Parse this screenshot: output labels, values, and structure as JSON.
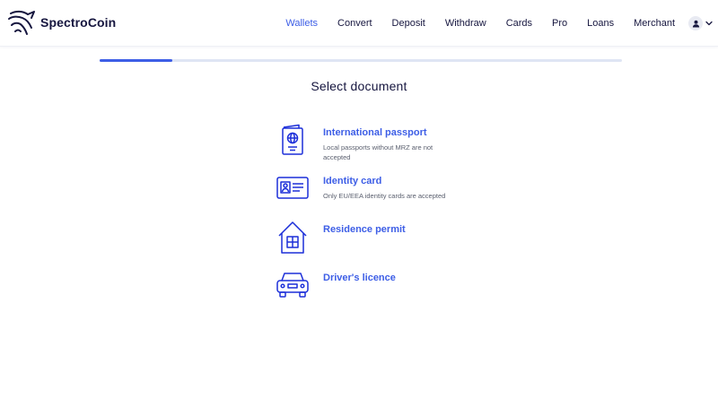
{
  "header": {
    "brand": "SpectroCoin",
    "nav": [
      {
        "label": "Wallets",
        "active": true
      },
      {
        "label": "Convert",
        "active": false
      },
      {
        "label": "Deposit",
        "active": false
      },
      {
        "label": "Withdraw",
        "active": false
      },
      {
        "label": "Cards",
        "active": false
      },
      {
        "label": "Pro",
        "active": false
      },
      {
        "label": "Loans",
        "active": false
      },
      {
        "label": "Merchant",
        "active": false
      }
    ],
    "user_icon": "user-icon"
  },
  "progress": {
    "fraction": 0.14
  },
  "page": {
    "title": "Select document"
  },
  "documents": [
    {
      "title": "International passport",
      "description": "Local passports without MRZ are not accepted",
      "icon": "passport-icon"
    },
    {
      "title": "Identity card",
      "description": "Only EU/EEA identity cards are accepted",
      "icon": "id-card-icon"
    },
    {
      "title": "Residence permit",
      "description": "",
      "icon": "house-icon"
    },
    {
      "title": "Driver's licence",
      "description": "",
      "icon": "car-icon"
    }
  ],
  "colors": {
    "accent": "#3d5ee6",
    "brand_dark": "#16163f",
    "progress_track": "#dfe5f4",
    "muted_text": "#5a5f6e"
  }
}
